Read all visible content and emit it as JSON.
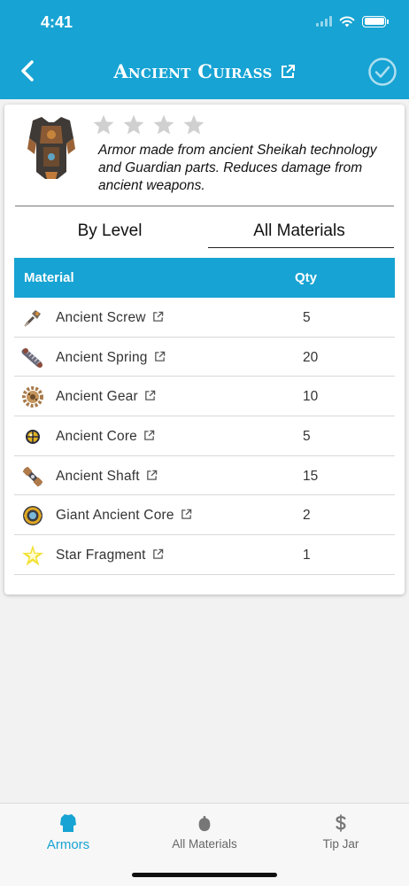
{
  "status_bar": {
    "time": "4:41"
  },
  "header": {
    "title": "Ancient Cuirass",
    "back_icon": "chevron-left-icon",
    "external_icon": "external-link-icon",
    "check_icon": "check-circle-icon"
  },
  "armor": {
    "image_icon": "ancient-cuirass-icon",
    "rating": {
      "value": 0,
      "max": 4
    },
    "description": "Armor made from ancient Sheikah technology and Guardian parts. Reduces damage from ancient weapons."
  },
  "tabs": [
    {
      "label": "By Level",
      "active": false
    },
    {
      "label": "All Materials",
      "active": true
    }
  ],
  "table": {
    "headers": {
      "material": "Material",
      "qty": "Qty"
    },
    "rows": [
      {
        "name": "Ancient Screw",
        "qty": "5",
        "icon": "ancient-screw-icon"
      },
      {
        "name": "Ancient Spring",
        "qty": "20",
        "icon": "ancient-spring-icon"
      },
      {
        "name": "Ancient Gear",
        "qty": "10",
        "icon": "ancient-gear-icon"
      },
      {
        "name": "Ancient Core",
        "qty": "5",
        "icon": "ancient-core-icon"
      },
      {
        "name": "Ancient Shaft",
        "qty": "15",
        "icon": "ancient-shaft-icon"
      },
      {
        "name": "Giant Ancient Core",
        "qty": "2",
        "icon": "giant-ancient-core-icon"
      },
      {
        "name": "Star Fragment",
        "qty": "1",
        "icon": "star-fragment-icon"
      }
    ]
  },
  "tabbar": [
    {
      "label": "Armors",
      "icon": "armor-icon",
      "active": true
    },
    {
      "label": "All Materials",
      "icon": "material-icon",
      "active": false
    },
    {
      "label": "Tip Jar",
      "icon": "dollar-icon",
      "active": false
    }
  ],
  "colors": {
    "accent": "#17a3d3",
    "star_inactive": "#d0d0d0"
  }
}
